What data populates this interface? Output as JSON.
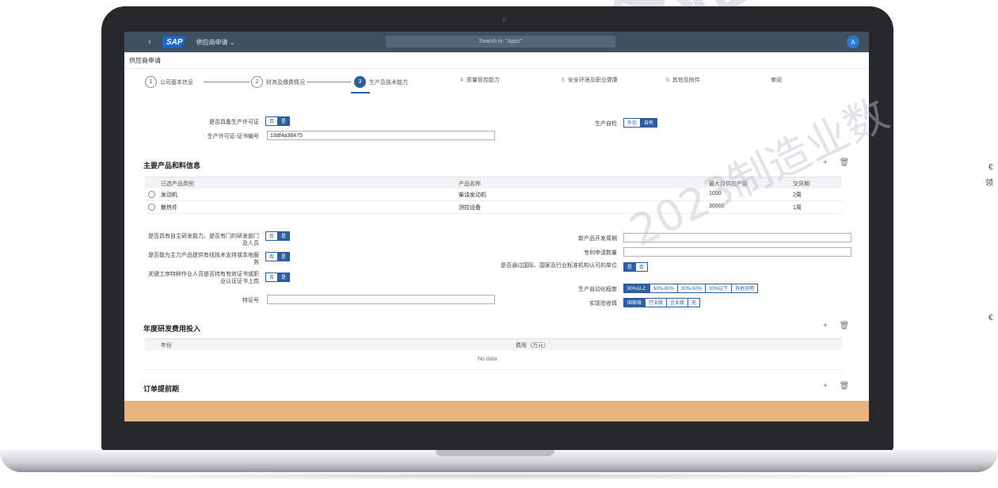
{
  "shell": {
    "back_icon": "‹",
    "logo": "SAP",
    "app_title": "供应商申请 ⌄",
    "search_placeholder": "Search in: \"Apps\"",
    "avatar": "A"
  },
  "page": {
    "title": "供应商申请"
  },
  "wizard": {
    "steps": [
      {
        "num": "1",
        "label": "公司基本信息"
      },
      {
        "num": "2",
        "label": "财务及缴费情况"
      },
      {
        "num": "3",
        "label": "生产及技术能力"
      },
      {
        "num": "4",
        "label": "质量管控能力"
      },
      {
        "num": "5",
        "label": "安全环境及职业健康"
      },
      {
        "num": "6",
        "label": "其他及附件"
      }
    ],
    "review": "审阅"
  },
  "production": {
    "license_label": "是否具备生产许可证",
    "license_toggle": [
      "否",
      "是"
    ],
    "license_no_label": "生产许可证-证书编号",
    "license_no_value": "13df4a38475",
    "mode_label": "生产自检",
    "mode_toggle": [
      "外包",
      "自有"
    ]
  },
  "products": {
    "title": "主要产品和料信息",
    "columns": [
      "已选产品类别",
      "产品名称",
      "最大月供应产能",
      "交货期"
    ],
    "rows": [
      {
        "cat": "发动机",
        "name": "柴油发动机",
        "cap": "1000",
        "lead": "2周"
      },
      {
        "cat": "散热件",
        "name": "测控设备",
        "cap": "30000",
        "lead": "1周"
      }
    ]
  },
  "rnd": {
    "q1_label": "是否具有自主研发能力，是否有门的研发部门及人员",
    "q1_toggle": [
      "否",
      "是"
    ],
    "q2_label": "是否能为主力产品提供有线技术支持或本地服务",
    "q2_toggle": [
      "否",
      "是"
    ],
    "q3_label": "关键工序特种作业人员是否持有有效证书或职业认证证书上岗",
    "q3_toggle": [
      "否",
      "是"
    ],
    "cert_label": "特证号",
    "new_products_label": "新产品开发周期",
    "patent_label": "专利申请数量",
    "cert_q_label": "是否通过国际、国家及行业标准机构认可的单位",
    "cert_q_toggle": [
      "是",
      "否"
    ],
    "automation_label": "生产自动化程度",
    "automation_options": [
      "80%以上",
      "50%-80%",
      "30%-50%",
      "30%以下",
      "其他说明"
    ],
    "eval_label": "实现验收情",
    "eval_options": [
      "国家级",
      "行业级",
      "企业级",
      "无"
    ]
  },
  "annual": {
    "title": "年度研发费用投入",
    "col_year": "年份",
    "col_amount": "费用（万元）",
    "empty": "No data"
  },
  "order": {
    "title": "订单提前期"
  },
  "toolbar": {
    "add": "+",
    "delete": "🗑"
  },
  "watermark": {
    "big": "企业",
    "text": "2023制造业数"
  },
  "edge": {
    "t1": "€",
    "t2": "领",
    "t3": "€"
  }
}
